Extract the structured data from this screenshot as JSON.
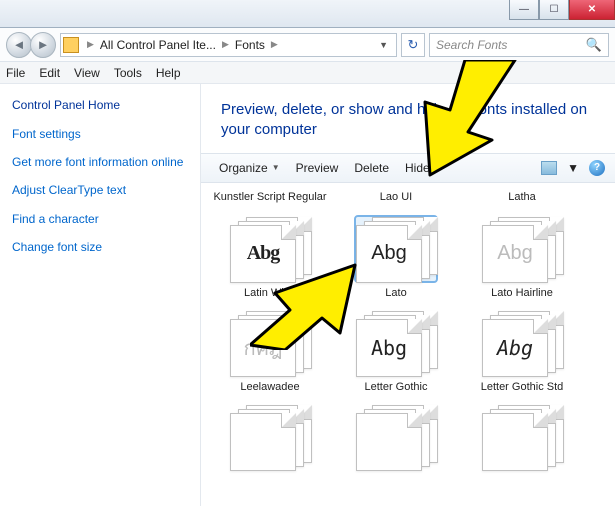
{
  "window": {
    "minimize": "—",
    "maximize": "☐",
    "close": "✕"
  },
  "nav": {
    "back": "◄",
    "forward": "►",
    "crumb1": "All Control Panel Ite...",
    "crumb2": "Fonts",
    "sep": "▶",
    "dropdown": "▼",
    "refresh": "↻"
  },
  "search": {
    "placeholder": "Search Fonts",
    "icon": "🔍"
  },
  "menu": {
    "file": "File",
    "edit": "Edit",
    "view": "View",
    "tools": "Tools",
    "help": "Help"
  },
  "sidebar": {
    "home": "Control Panel Home",
    "links": [
      "Font settings",
      "Get more font information online",
      "Adjust ClearType text",
      "Find a character",
      "Change font size"
    ]
  },
  "heading": "Preview, delete, or show and hide the fonts installed on your computer",
  "toolbar": {
    "organize": "Organize",
    "preview": "Preview",
    "delete": "Delete",
    "hide": "Hide",
    "dd": "▼",
    "help": "?"
  },
  "fonts": {
    "row1": [
      "Kunstler Script Regular",
      "Lao UI",
      "Latha"
    ],
    "row2": {
      "items": [
        "Latin Wide",
        "Lato",
        "Lato Hairline"
      ],
      "samples": [
        "Abg",
        "Abg",
        "Abg"
      ]
    },
    "row3": {
      "items": [
        "Leelawadee",
        "Letter Gothic",
        "Letter Gothic Std"
      ],
      "samples": [
        "กคฎ",
        "Abg",
        "Abg"
      ]
    }
  }
}
